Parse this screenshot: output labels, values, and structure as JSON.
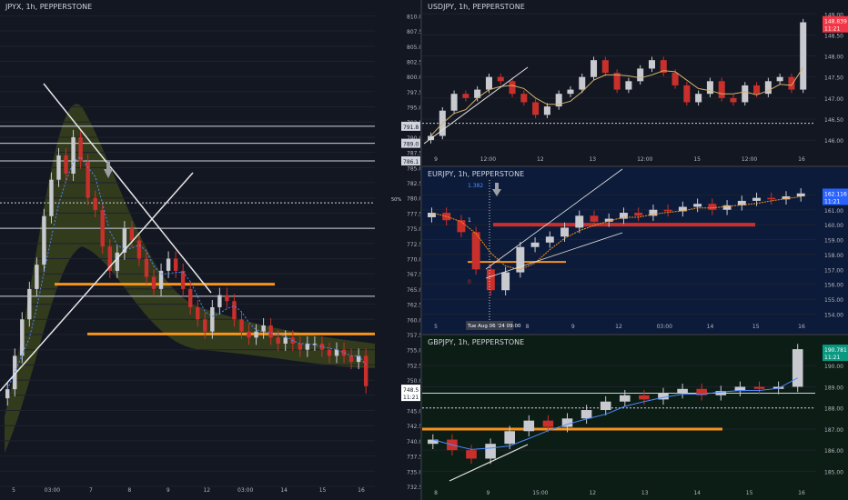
{
  "panels": {
    "left": {
      "title": "JPYX, 1h, PEPPERSTONE",
      "y_ticks": [
        "810.0",
        "807.5",
        "805.0",
        "802.5",
        "800.0",
        "797.5",
        "795.0",
        "792.5",
        "790.0",
        "787.5",
        "785.0",
        "782.5",
        "780.0",
        "777.5",
        "775.0",
        "772.5",
        "770.0",
        "767.5",
        "765.0",
        "762.5",
        "760.0",
        "757.5",
        "755.0",
        "752.5",
        "750.0",
        "747.5",
        "745.0",
        "742.5",
        "740.0",
        "737.5",
        "735.0",
        "732.5"
      ],
      "x_ticks": [
        "5",
        "03:00",
        "7",
        "8",
        "9",
        "12",
        "03:00",
        "14",
        "15",
        "16"
      ],
      "price_labels": [
        "791.8",
        "789.0",
        "786.1",
        "748.5",
        "11:21"
      ],
      "marker_label": "50%"
    },
    "usdjpy": {
      "title": "USDJPY, 1h, PEPPERSTONE",
      "y_ticks": [
        "149.00",
        "148.50",
        "148.00",
        "147.50",
        "147.00",
        "146.50",
        "146.00"
      ],
      "x_ticks": [
        "9",
        "12:00",
        "12",
        "13",
        "12:00",
        "15",
        "12:00",
        "16"
      ],
      "price_label": "148.839",
      "time_label": "11:21"
    },
    "eurjpy": {
      "title": "EURJPY, 1h, PEPPERSTONE",
      "y_ticks": [
        "162.00",
        "161.00",
        "160.00",
        "159.00",
        "158.00",
        "157.00",
        "156.00",
        "155.00",
        "154.00"
      ],
      "x_ticks": [
        "5",
        "7",
        "8",
        "9",
        "12",
        "03:00",
        "14",
        "15",
        "16"
      ],
      "price_label": "162.116",
      "time_label": "11:21",
      "cursor_label": "Tue Aug 06 '24 09:00",
      "annotation": "1.382",
      "marker_zero": "0",
      "marker_one": "1"
    },
    "gbpjpy": {
      "title": "GBPJPY, 1h, PEPPERSTONE",
      "y_ticks": [
        "190.00",
        "189.00",
        "188.00",
        "187.00",
        "186.00",
        "185.00"
      ],
      "x_ticks": [
        "8",
        "9",
        "15:00",
        "12",
        "13",
        "14",
        "15",
        "16"
      ],
      "price_label": "190.781",
      "time_label": "11:21"
    }
  },
  "colors": {
    "background": "#131722",
    "bull": "#c9cad0",
    "bear": "#c9302c",
    "orange": "#f7931a",
    "price_red": "#f23645",
    "price_blue": "#2962ff",
    "price_green": "#089981"
  },
  "chart_data": [
    {
      "type": "candlestick",
      "title": "JPYX, 1h, PEPPERSTONE",
      "ylim": [
        731,
        812
      ],
      "close": [
        748.5,
        754,
        760,
        765,
        769,
        777,
        783,
        787,
        784,
        790,
        786,
        780,
        778,
        772,
        768,
        771,
        775,
        773,
        770,
        767,
        765,
        768,
        770,
        768,
        765,
        762,
        760,
        758,
        762,
        764,
        763,
        760,
        758,
        757,
        758,
        759,
        757,
        756,
        757,
        756,
        755,
        756,
        756,
        755,
        754,
        755,
        754,
        753,
        754,
        749
      ],
      "horizontal_levels": [
        791.8,
        789.0,
        786.1,
        779.2,
        775.0,
        765.8,
        763.8,
        757.6
      ],
      "last_price": 748.5
    },
    {
      "type": "candlestick",
      "title": "USDJPY, 1h, PEPPERSTONE",
      "ylim": [
        145.7,
        149.2
      ],
      "close": [
        146.1,
        146.7,
        147.1,
        147.0,
        147.2,
        147.5,
        147.4,
        147.1,
        146.9,
        146.6,
        146.8,
        147.1,
        147.2,
        147.5,
        147.9,
        147.6,
        147.2,
        147.4,
        147.7,
        147.9,
        147.6,
        147.3,
        146.9,
        147.1,
        147.4,
        147.0,
        146.9,
        147.3,
        147.1,
        147.4,
        147.5,
        147.2,
        148.8
      ],
      "horizontal_levels": [
        146.4
      ],
      "last_price": 148.839
    },
    {
      "type": "candlestick",
      "title": "EURJPY, 1h, PEPPERSTONE",
      "ylim": [
        153.6,
        163.0
      ],
      "close": [
        160.8,
        160.3,
        159.5,
        157.0,
        155.6,
        156.8,
        158.5,
        158.8,
        159.2,
        159.8,
        160.6,
        160.2,
        160.4,
        160.8,
        160.6,
        161.0,
        160.9,
        161.2,
        161.4,
        161.0,
        161.3,
        161.6,
        161.8,
        161.7,
        161.9,
        162.1
      ],
      "horizontal_levels": [
        160.0,
        157.5
      ],
      "last_price": 162.116
    },
    {
      "type": "candlestick",
      "title": "GBPJPY, 1h, PEPPERSTONE",
      "ylim": [
        184.2,
        191.0
      ],
      "close": [
        186.5,
        186.0,
        185.6,
        186.3,
        186.9,
        187.4,
        187.1,
        187.5,
        187.9,
        188.3,
        188.6,
        188.4,
        188.7,
        188.9,
        188.6,
        188.8,
        189.0,
        188.9,
        189.0,
        190.78
      ],
      "horizontal_levels": [
        188.7,
        188.0,
        187.0
      ],
      "last_price": 190.781
    }
  ]
}
